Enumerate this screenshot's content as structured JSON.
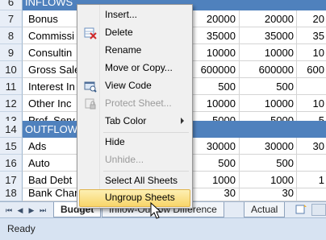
{
  "sheet": {
    "rows": [
      {
        "num": "6",
        "a": "INFLOWS",
        "b": "",
        "c": "",
        "d": "",
        "e": "",
        "header": true
      },
      {
        "num": "7",
        "a": "Bonus",
        "b": "",
        "c": "20000",
        "d": "20000",
        "e": "20"
      },
      {
        "num": "8",
        "a": "Commissi",
        "b": "",
        "c": "35000",
        "d": "35000",
        "e": "35"
      },
      {
        "num": "9",
        "a": "Consultin",
        "b": "",
        "c": "10000",
        "d": "10000",
        "e": "10"
      },
      {
        "num": "10",
        "a": "Gross Sale",
        "b": "",
        "c": "600000",
        "d": "600000",
        "e": "600"
      },
      {
        "num": "11",
        "a": "Interest In",
        "b": "",
        "c": "500",
        "d": "500",
        "e": ""
      },
      {
        "num": "12",
        "a": "Other Inc",
        "b": "",
        "c": "10000",
        "d": "10000",
        "e": "10"
      },
      {
        "num": "13",
        "a": "Prof. Serv",
        "b": "",
        "c": "5000",
        "d": "5000",
        "e": "5"
      },
      {
        "num": "14",
        "a": "OUTFLOWS",
        "b": "",
        "c": "",
        "d": "",
        "e": "",
        "header": true
      },
      {
        "num": "15",
        "a": "Ads",
        "b": "",
        "c": "30000",
        "d": "30000",
        "e": "30"
      },
      {
        "num": "16",
        "a": "Auto",
        "b": "",
        "c": "500",
        "d": "500",
        "e": ""
      },
      {
        "num": "17",
        "a": "Bad Debt",
        "b": "",
        "c": "1000",
        "d": "1000",
        "e": "1"
      },
      {
        "num": "18",
        "a": "Bank Char",
        "b": "",
        "c": "30",
        "d": "30",
        "e": ""
      }
    ]
  },
  "context_menu": {
    "items": [
      {
        "label": "Insert...",
        "icon": "",
        "disabled": false,
        "submenu": false
      },
      {
        "label": "Delete",
        "icon": "delete-sheet-icon",
        "disabled": false,
        "submenu": false
      },
      {
        "label": "Rename",
        "icon": "",
        "disabled": false,
        "submenu": false
      },
      {
        "label": "Move or Copy...",
        "icon": "",
        "disabled": false,
        "submenu": false
      },
      {
        "label": "View Code",
        "icon": "view-code-icon",
        "disabled": false,
        "submenu": false
      },
      {
        "label": "Protect Sheet...",
        "icon": "protect-sheet-icon",
        "disabled": true,
        "submenu": false
      },
      {
        "label": "Tab Color",
        "icon": "",
        "disabled": false,
        "submenu": true
      },
      {
        "label": "Hide",
        "icon": "",
        "disabled": false,
        "submenu": false
      },
      {
        "label": "Unhide...",
        "icon": "",
        "disabled": true,
        "submenu": false
      },
      {
        "label": "Select All Sheets",
        "icon": "",
        "disabled": false,
        "submenu": false
      },
      {
        "label": "Ungroup Sheets",
        "icon": "",
        "disabled": false,
        "submenu": false,
        "highlighted": true
      }
    ]
  },
  "tabs": [
    {
      "label": "Budget",
      "active": true
    },
    {
      "label": "Inflow-Outflow Difference",
      "active": false
    },
    {
      "label": "Actual",
      "active": false
    }
  ],
  "status_bar": {
    "text": "Ready"
  },
  "colors": {
    "header_fill": "#4f81bd",
    "highlight": "#f8d56a"
  }
}
